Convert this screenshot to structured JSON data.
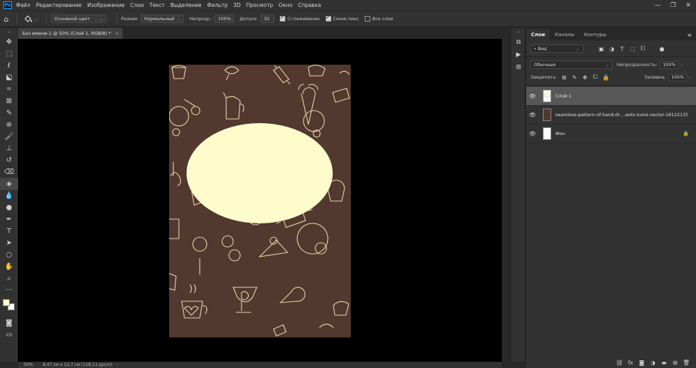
{
  "menubar": {
    "logo": "Ps",
    "items": [
      "Файл",
      "Редактирование",
      "Изображение",
      "Слои",
      "Текст",
      "Выделение",
      "Фильтр",
      "3D",
      "Просмотр",
      "Окно",
      "Справка"
    ],
    "minimize": "—",
    "maximize": "❐",
    "close": "✕"
  },
  "options": {
    "fill_source": "Основной цвет",
    "mode_label": "Режим:",
    "mode_value": "Нормальный",
    "opacity_label": "Непрозр.:",
    "opacity_value": "100%",
    "tolerance_label": "Допуск:",
    "tolerance_value": "32",
    "antialias_label": "Сглаживание",
    "contiguous_label": "Смеж.пикс",
    "all_layers_label": "Все слои"
  },
  "document": {
    "tab_title": "Без имени-1 @ 50% (Слой 1, RGB/8) *",
    "tab_close": "×",
    "zoom": "50%",
    "doc_info": "8,47 см x 12,7 см (118,11 ppcm)",
    "status_arrow": "›"
  },
  "colors": {
    "foreground": "#fffccc",
    "background": "#ffffff",
    "canvas_bg": "#52382f",
    "pattern_line": "#e8d9a8",
    "oval": "#fffccc"
  },
  "layers_panel": {
    "tabs": [
      "Слои",
      "Каналы",
      "Контуры"
    ],
    "filter_value": "Вид",
    "blend_mode": "Обычные",
    "opacity_label": "Непрозрачность:",
    "opacity_value": "100%",
    "lock_label": "Закрепить:",
    "fill_label": "Заливка:",
    "fill_value": "100%",
    "layers": [
      {
        "name": "Слой 1",
        "selected": true
      },
      {
        "name": "seamless-pattern-of-hand-dr....eets-icons-vector-16122135",
        "selected": false
      },
      {
        "name": "Фон",
        "selected": false,
        "locked": true
      }
    ]
  }
}
